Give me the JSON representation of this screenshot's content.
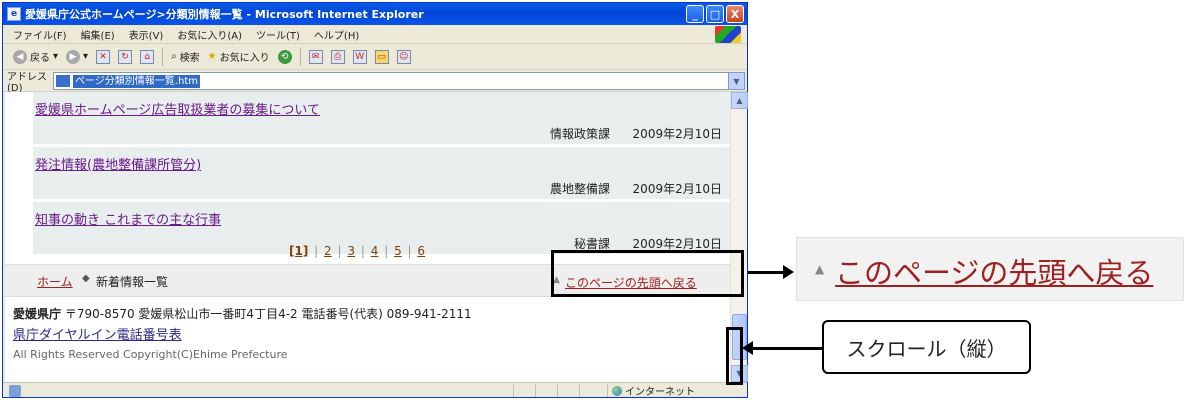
{
  "window": {
    "title": "愛媛県庁公式ホームページ>分類別情報一覧 - Microsoft Internet Explorer",
    "minimize": "_",
    "maximize": "□",
    "close": "X"
  },
  "menu": {
    "items": [
      "ファイル(F)",
      "編集(E)",
      "表示(V)",
      "お気に入り(A)",
      "ツール(T)",
      "ヘルプ(H)"
    ]
  },
  "toolbar": {
    "back": "戻る",
    "search": "検索",
    "favorites": "お気に入り"
  },
  "address": {
    "label": "アドレス(D)",
    "value": "ページ分類別情報一覧.htm"
  },
  "news": [
    {
      "title": "愛媛県ホームページ広告取扱業者の募集について",
      "dept": "情報政策課",
      "date": "2009年2月10日"
    },
    {
      "title": "発注情報(農地整備課所管分)",
      "dept": "農地整備課",
      "date": "2009年2月10日"
    },
    {
      "title": "知事の動き これまでの主な行事",
      "dept": "秘書課",
      "date": "2009年2月10日"
    }
  ],
  "pager": {
    "current": "[1]",
    "pages": [
      "2",
      "3",
      "4",
      "5",
      "6"
    ],
    "separator": "|"
  },
  "breadcrumb": {
    "home": "ホーム",
    "separator": "◆",
    "current": "新着情報一覧"
  },
  "back_to_top": "このページの先頭へ戻る",
  "footer": {
    "org": "愛媛県庁",
    "address": "〒790-8570 愛媛県松山市一番町4丁目4-2 電話番号(代表) 089-941-2111",
    "dial_link": "県庁ダイヤルイン電話番号表",
    "copyright": "All Rights Reserved Copyright(C)Ehime Prefecture"
  },
  "status": {
    "zone": "インターネット"
  },
  "annotations": {
    "zoom_label": "このページの先頭へ戻る",
    "scroll_label": "スクロール（縦）"
  }
}
